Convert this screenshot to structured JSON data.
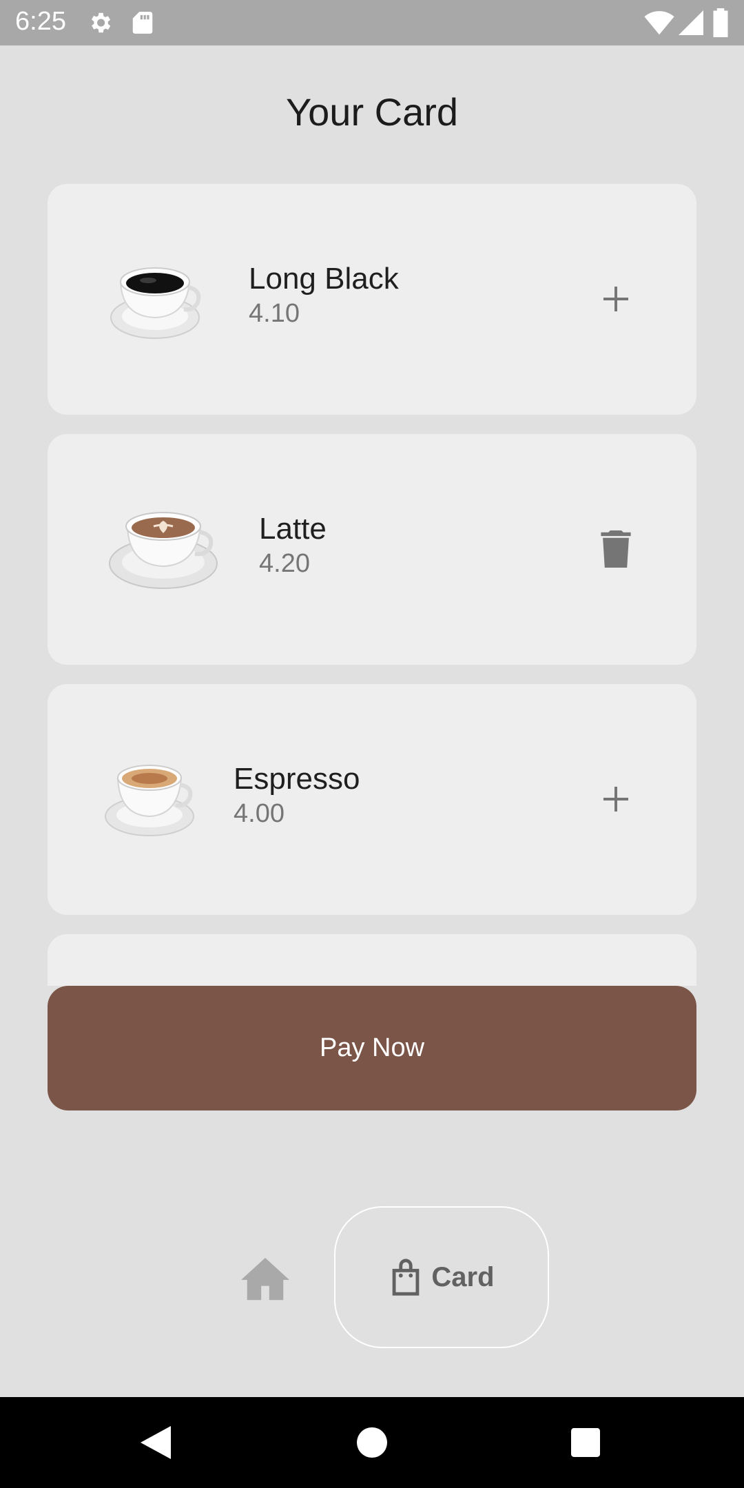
{
  "status_bar": {
    "time": "6:25",
    "icons": [
      "settings-icon",
      "sd-card-icon",
      "wifi-icon",
      "signal-icon",
      "battery-icon"
    ]
  },
  "page": {
    "title": "Your Card"
  },
  "cart": {
    "items": [
      {
        "name": "Long Black",
        "price": "4.10",
        "image": "long-black-cup",
        "action": "add-icon"
      },
      {
        "name": "Latte",
        "price": "4.20",
        "image": "latte-cup",
        "action": "delete-icon"
      },
      {
        "name": "Espresso",
        "price": "4.00",
        "image": "espresso-cup",
        "action": "add-icon"
      }
    ]
  },
  "pay_button": {
    "label": "Pay Now",
    "color": "#7b5548"
  },
  "bottom_nav": {
    "home_icon": "home-icon",
    "card_icon": "shopping-bag-icon",
    "card_label": "Card"
  },
  "system_nav": {
    "icons": [
      "back-icon",
      "home-circle-icon",
      "recents-icon"
    ]
  }
}
